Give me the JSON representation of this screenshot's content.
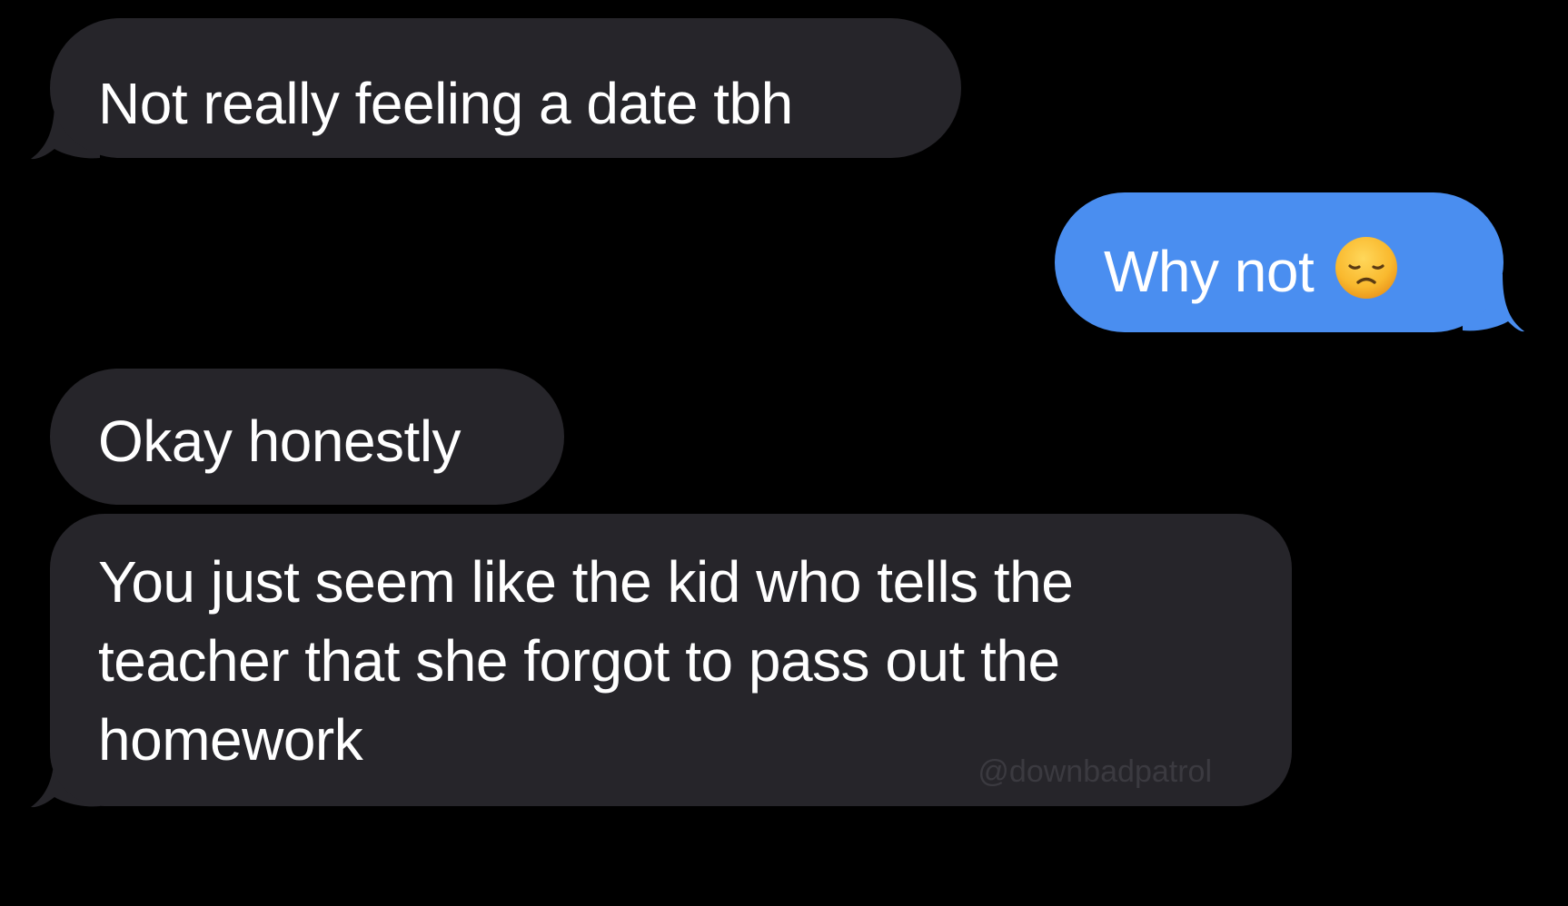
{
  "messages": [
    {
      "direction": "received",
      "text": "Not really feeling a date tbh"
    },
    {
      "direction": "sent",
      "text": "Why not",
      "emoji": "disappointed-face-emoji"
    },
    {
      "direction": "received",
      "text": "Okay honestly"
    },
    {
      "direction": "received",
      "text": "You just seem like the kid who tells the teacher that she forgot to pass out the homework"
    }
  ],
  "watermark": "@downbadpatrol",
  "colors": {
    "background": "#000000",
    "received_bubble": "#26252a",
    "sent_bubble": "#4a8ef0",
    "text": "#ffffff",
    "watermark": "#3b3a40"
  }
}
